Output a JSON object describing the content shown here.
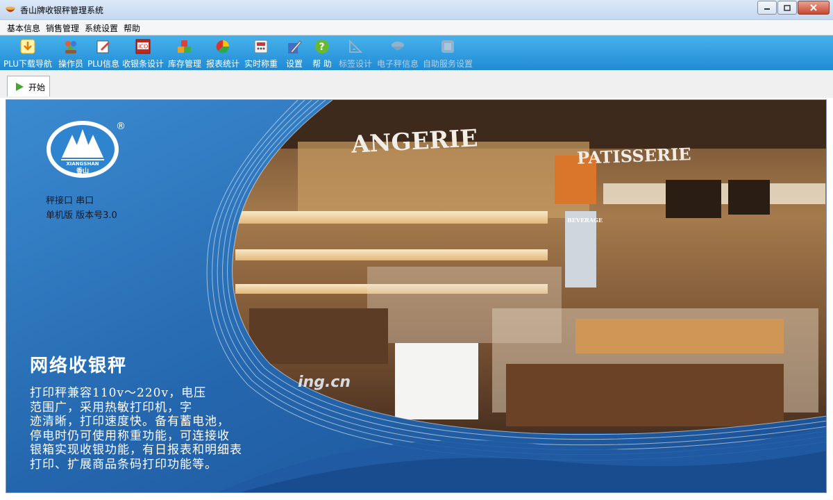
{
  "window": {
    "title": "香山牌收银秤管理系统"
  },
  "menu": [
    "基本信息",
    "销售管理",
    "系统设置",
    "帮助"
  ],
  "toolbar": {
    "items": [
      {
        "label": "PLU下载导航",
        "icon": "download-arrow-icon",
        "enabled": true
      },
      {
        "label": "操作员",
        "icon": "users-icon",
        "enabled": true
      },
      {
        "label": "PLU信息",
        "icon": "edit-note-icon",
        "enabled": true
      },
      {
        "label": "收银条设计",
        "icon": "receipt-design-icon",
        "enabled": true
      },
      {
        "label": "库存管理",
        "icon": "inventory-boxes-icon",
        "enabled": true
      },
      {
        "label": "报表统计",
        "icon": "pie-chart-icon",
        "enabled": true
      },
      {
        "label": "实时称重",
        "icon": "scale-icon",
        "enabled": true
      },
      {
        "label": "设置",
        "icon": "settings-tools-icon",
        "enabled": true
      },
      {
        "label": "帮 助",
        "icon": "help-icon",
        "enabled": true
      },
      {
        "label": "标签设计",
        "icon": "label-design-icon",
        "enabled": false
      },
      {
        "label": "电子秤信息",
        "icon": "scale-info-icon",
        "enabled": false
      },
      {
        "label": "自助服务设置",
        "icon": "self-service-icon",
        "enabled": false
      }
    ]
  },
  "tab": {
    "label": "开始"
  },
  "splash": {
    "logo_text": "XIANGSHAN",
    "logo_cn": "香山",
    "registered": "®",
    "info_line1": "秤接口 串口",
    "info_line2": "单机版 版本号3.0",
    "headline": "网络收银秤",
    "paragraph": [
      "打印秤兼容110v～220v，电压",
      "范围广，采用热敏打印机，字",
      "迹清晰，打印速度快。备有蓄电池，",
      "停电时仍可使用称重功能，可连接收",
      "银箱实现收银功能，有日报表和明细表",
      "打印、扩展商品条码打印功能等。"
    ],
    "photo_sign1": "ANGERIE",
    "photo_sign2": "PATISSERIE",
    "photo_sign3": "BEVERAGE",
    "watermark": "ing.cn"
  },
  "colors": {
    "toolbar_top": "#47b2ea",
    "toolbar_bottom": "#1f8bd6",
    "splash_blue": "#2b73b9"
  }
}
